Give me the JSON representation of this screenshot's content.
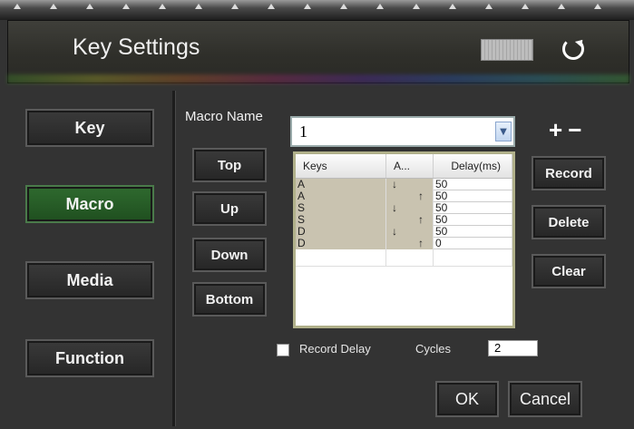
{
  "window": {
    "title": "Key Settings"
  },
  "icons": {
    "keyboard": "keyboard-icon",
    "reset": "reset-icon"
  },
  "nav": [
    {
      "label": "Key",
      "active": false
    },
    {
      "label": "Macro",
      "active": true
    },
    {
      "label": "Media",
      "active": false
    },
    {
      "label": "Function",
      "active": false
    }
  ],
  "order_buttons": {
    "top": "Top",
    "up": "Up",
    "down": "Down",
    "bottom": "Bottom"
  },
  "macro": {
    "name_label": "Macro Name",
    "name_value": "1",
    "add_label": "+",
    "remove_label": "−"
  },
  "table": {
    "headers": [
      "Keys",
      "A...",
      "Delay(ms)"
    ],
    "rows": [
      {
        "key": "A",
        "action": "↓",
        "delay": "50"
      },
      {
        "key": "A",
        "action": "↑",
        "delay": "50"
      },
      {
        "key": "S",
        "action": "↓",
        "delay": "50"
      },
      {
        "key": "S",
        "action": "↑",
        "delay": "50"
      },
      {
        "key": "D",
        "action": "↓",
        "delay": "50"
      },
      {
        "key": "D",
        "action": "↑",
        "delay": "0"
      }
    ]
  },
  "actions": {
    "record": "Record",
    "delete": "Delete",
    "clear": "Clear"
  },
  "options": {
    "record_delay_label": "Record Delay",
    "cycles_label": "Cycles",
    "cycles_value": "2"
  },
  "footer": {
    "ok": "OK",
    "cancel": "Cancel"
  },
  "colors": {
    "active_nav": "#2f6a2f",
    "background": "#333333",
    "table_key_cells": "#c9c3b0"
  }
}
